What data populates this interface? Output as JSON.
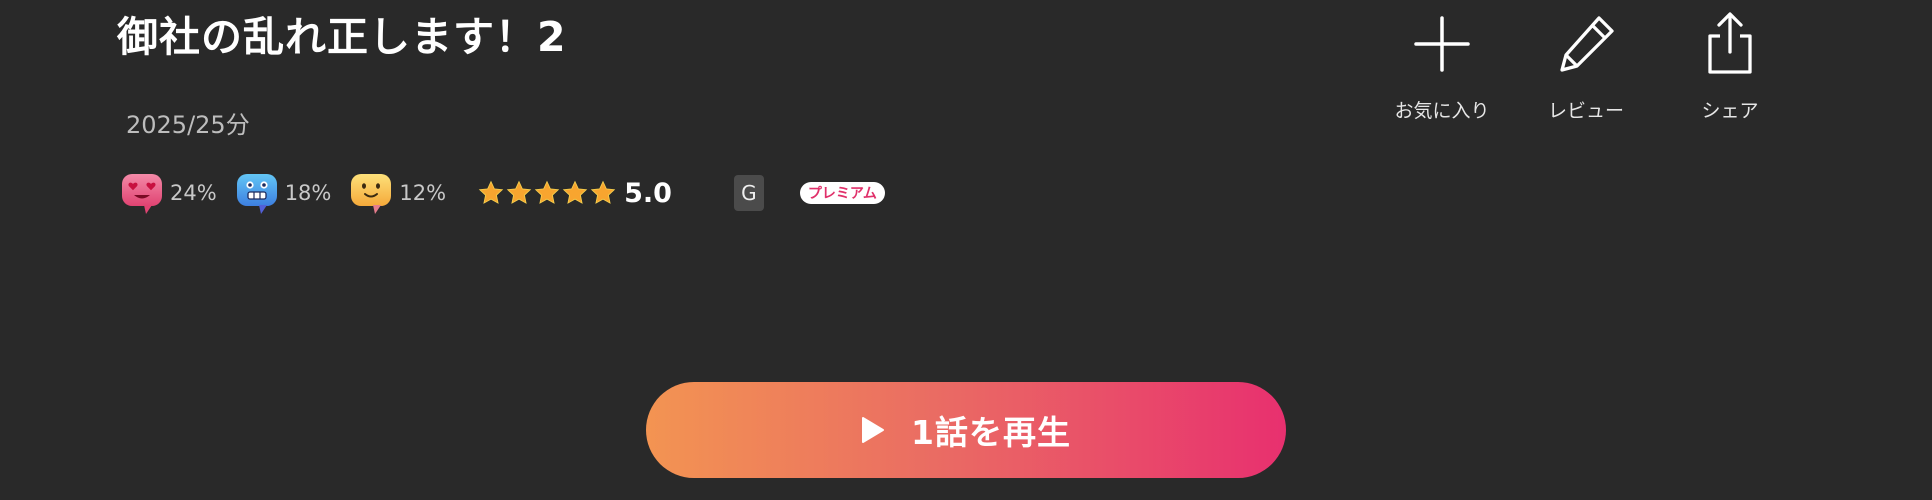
{
  "title": "御社の乱れ正します！2",
  "meta": "2025/25分",
  "reactions": [
    {
      "icon": "heart-eyes-face-icon",
      "percent": "24%",
      "color": "#e9577e"
    },
    {
      "icon": "grinning-robot-face-icon",
      "percent": "18%",
      "color": "#3fa3e8"
    },
    {
      "icon": "smiling-face-icon",
      "percent": "12%",
      "color": "#f5c242"
    }
  ],
  "rating": {
    "stars": 5,
    "value": "5.0"
  },
  "age_rating": "G",
  "premium_label": "プレミアム",
  "actions": [
    {
      "icon": "plus-icon",
      "label": "お気に入り"
    },
    {
      "icon": "pencil-icon",
      "label": "レビュー"
    },
    {
      "icon": "share-icon",
      "label": "シェア"
    }
  ],
  "play_button": {
    "label": "1話を再生",
    "gradient_start": "#f39452",
    "gradient_end": "#e8306f"
  }
}
